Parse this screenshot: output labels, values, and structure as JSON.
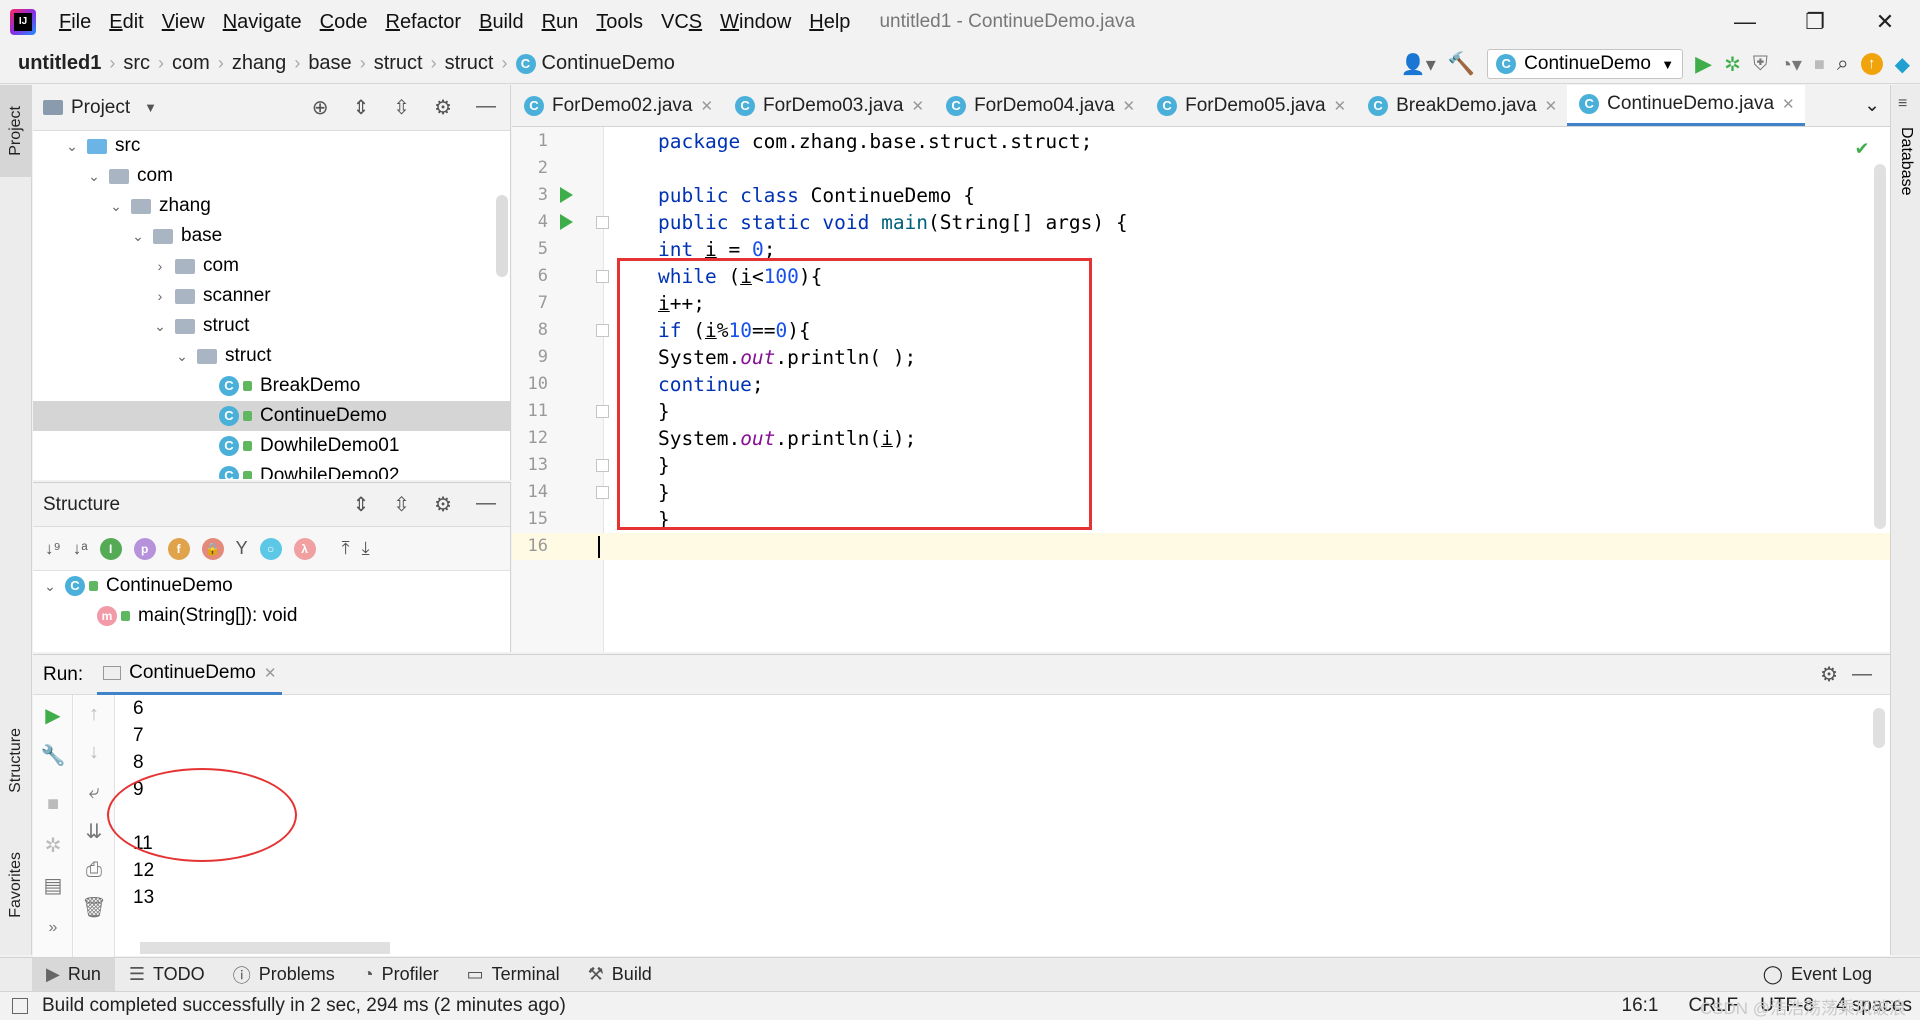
{
  "menu": {
    "items": [
      "File",
      "Edit",
      "View",
      "Navigate",
      "Code",
      "Refactor",
      "Build",
      "Run",
      "Tools",
      "VCS",
      "Window",
      "Help"
    ],
    "mnemonics": [
      "F",
      "E",
      "V",
      "N",
      "C",
      "R",
      "B",
      "R",
      "T",
      "S",
      "W",
      "H"
    ],
    "window_title": "untitled1 - ContinueDemo.java"
  },
  "breadcrumb": [
    "untitled1",
    "src",
    "com",
    "zhang",
    "base",
    "struct",
    "struct",
    "ContinueDemo"
  ],
  "run_config": {
    "label": "ContinueDemo"
  },
  "sidebar_left": {
    "project_tab": "Project",
    "structure_tab": "Structure",
    "favorites_tab": "Favorites"
  },
  "sidebar_right": {
    "database_tab": "Database"
  },
  "project": {
    "title": "Project",
    "tree": [
      {
        "label": "src",
        "depth": 1,
        "expanded": true,
        "kind": "folder-src"
      },
      {
        "label": "com",
        "depth": 2,
        "expanded": true,
        "kind": "folder"
      },
      {
        "label": "zhang",
        "depth": 3,
        "expanded": true,
        "kind": "folder"
      },
      {
        "label": "base",
        "depth": 4,
        "expanded": true,
        "kind": "folder"
      },
      {
        "label": "com",
        "depth": 5,
        "expanded": false,
        "kind": "folder"
      },
      {
        "label": "scanner",
        "depth": 5,
        "expanded": false,
        "kind": "folder"
      },
      {
        "label": "struct",
        "depth": 5,
        "expanded": true,
        "kind": "folder"
      },
      {
        "label": "struct",
        "depth": 6,
        "expanded": true,
        "kind": "folder"
      },
      {
        "label": "BreakDemo",
        "depth": 7,
        "kind": "class"
      },
      {
        "label": "ContinueDemo",
        "depth": 7,
        "kind": "class",
        "selected": true
      },
      {
        "label": "DowhileDemo01",
        "depth": 7,
        "kind": "class"
      },
      {
        "label": "DowhileDemo02",
        "depth": 7,
        "kind": "class"
      }
    ]
  },
  "structure": {
    "title": "Structure",
    "class_name": "ContinueDemo",
    "method": "main(String[]): void"
  },
  "editor": {
    "tabs": [
      "ForDemo02.java",
      "ForDemo03.java",
      "ForDemo04.java",
      "ForDemo05.java",
      "BreakDemo.java",
      "ContinueDemo.java"
    ],
    "active_tab": 5,
    "lines": [
      {
        "n": "1",
        "html": "<span class=\"kw\">package</span> com.zhang.base.struct.struct;"
      },
      {
        "n": "2",
        "html": ""
      },
      {
        "n": "3",
        "html": "<span class=\"kw\">public class</span> ContinueDemo {"
      },
      {
        "n": "4",
        "html": "<span class=\"kw\">public static void</span> <span style=\"color:#00627a\">main</span>(String[] args) {"
      },
      {
        "n": "5",
        "html": "<span class=\"kw\">int</span> <span class=\"var\">i</span> = <span class=\"num\">0</span>;"
      },
      {
        "n": "6",
        "html": "<span class=\"kw\">while</span> (<span class=\"var\">i</span>&lt;<span class=\"num\">100</span>){"
      },
      {
        "n": "7",
        "html": "<span class=\"var\">i</span>++;"
      },
      {
        "n": "8",
        "html": "<span class=\"kw\">if</span> (<span class=\"var\">i</span>%<span class=\"num\">10</span>==<span class=\"num\">0</span>){"
      },
      {
        "n": "9",
        "html": "System.<span class=\"fld\">out</span>.println( );"
      },
      {
        "n": "10",
        "html": "<span class=\"kw\">continue</span>;"
      },
      {
        "n": "11",
        "html": "}"
      },
      {
        "n": "12",
        "html": "System.<span class=\"fld\">out</span>.println(<span class=\"var\">i</span>);"
      },
      {
        "n": "13",
        "html": "}"
      },
      {
        "n": "14",
        "html": "}"
      },
      {
        "n": "15",
        "html": "}"
      },
      {
        "n": "16",
        "html": ""
      }
    ]
  },
  "run": {
    "label": "Run:",
    "tab": "ContinueDemo",
    "output": [
      "6",
      "7",
      "8",
      "9",
      "",
      "11",
      "12",
      "13"
    ]
  },
  "bottom_tabs": [
    "Run",
    "TODO",
    "Problems",
    "Profiler",
    "Terminal",
    "Build"
  ],
  "event_log": "Event Log",
  "status": {
    "message": "Build completed successfully in 2 sec, 294 ms (2 minutes ago)",
    "position": "16:1",
    "line_sep": "CRLF",
    "encoding": "UTF-8",
    "indent": "4 spaces",
    "watermark": "CSDN @浩浩荡荡乘风破浪"
  }
}
